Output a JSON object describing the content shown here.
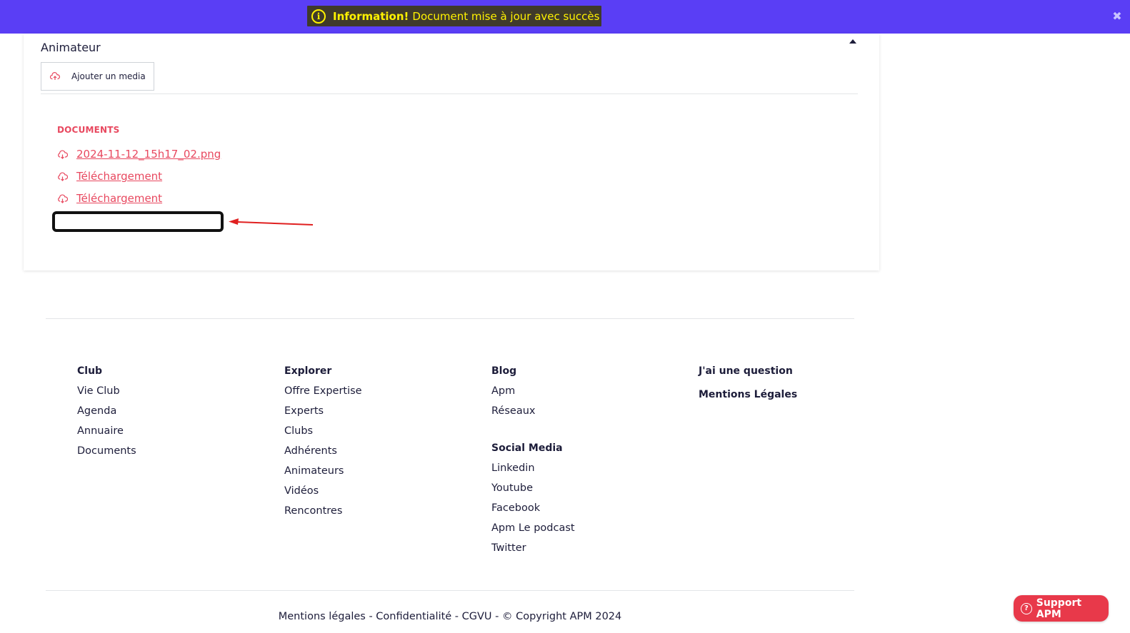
{
  "notification": {
    "strong": "Information!",
    "message": "Document mise à jour avec succès",
    "close_glyph": "✖",
    "info_glyph": "i"
  },
  "card": {
    "title": "Animateur",
    "add_media_label": "Ajouter un media",
    "documents_heading": "DOCUMENTS",
    "documents": [
      "2024-11-12_15h17_02.png",
      "Téléchargement",
      "Téléchargement"
    ]
  },
  "footer": {
    "club": {
      "heading": "Club",
      "items": [
        "Vie Club",
        "Agenda",
        "Annuaire",
        "Documents"
      ]
    },
    "explorer": {
      "heading": "Explorer",
      "items": [
        "Offre Expertise",
        "Experts",
        "Clubs",
        "Adhérents",
        "Animateurs",
        "Vidéos",
        "Rencontres"
      ]
    },
    "blog": {
      "heading": "Blog",
      "items": [
        "Apm",
        "Réseaux"
      ]
    },
    "social": {
      "heading": "Social Media",
      "items": [
        "Linkedin",
        "Youtube",
        "Facebook",
        "Apm Le podcast",
        "Twitter"
      ]
    },
    "extra": {
      "question": "J'ai une question",
      "mentions": "Mentions Légales"
    },
    "legal": "Mentions légales - Confidentialité - CGVU - © Copyright APM 2024"
  },
  "support": {
    "label": "Support APM",
    "glyph": "?"
  },
  "colors": {
    "topbar": "#5a3ef5",
    "accent": "#e8485f",
    "notice_text": "#fff200",
    "support": "#e8394a"
  }
}
